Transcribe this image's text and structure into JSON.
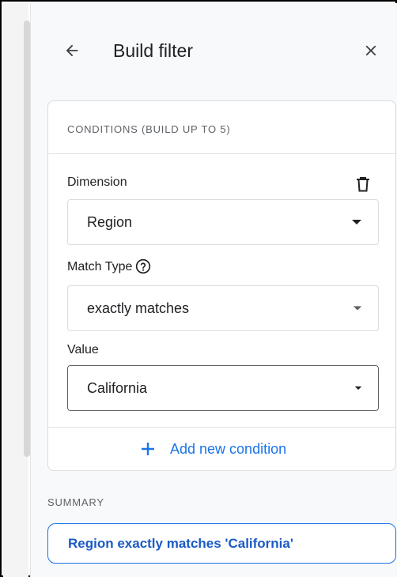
{
  "header": {
    "title": "Build filter",
    "back_icon": "arrow-left-icon",
    "close_icon": "close-icon"
  },
  "conditions": {
    "heading": "CONDITIONS (BUILD UP TO 5)",
    "dimension": {
      "label": "Dimension",
      "value": "Region",
      "delete_icon": "trash-icon"
    },
    "match_type": {
      "label": "Match Type",
      "value": "exactly matches",
      "help_icon": "help-circle-icon"
    },
    "value": {
      "label": "Value",
      "value": "California"
    },
    "add_label": "Add new condition"
  },
  "summary": {
    "heading": "SUMMARY",
    "text": "Region exactly matches 'California'"
  },
  "colors": {
    "accent": "#1a73e8",
    "text": "#202124",
    "muted": "#5f6368",
    "border": "#dadce0"
  }
}
